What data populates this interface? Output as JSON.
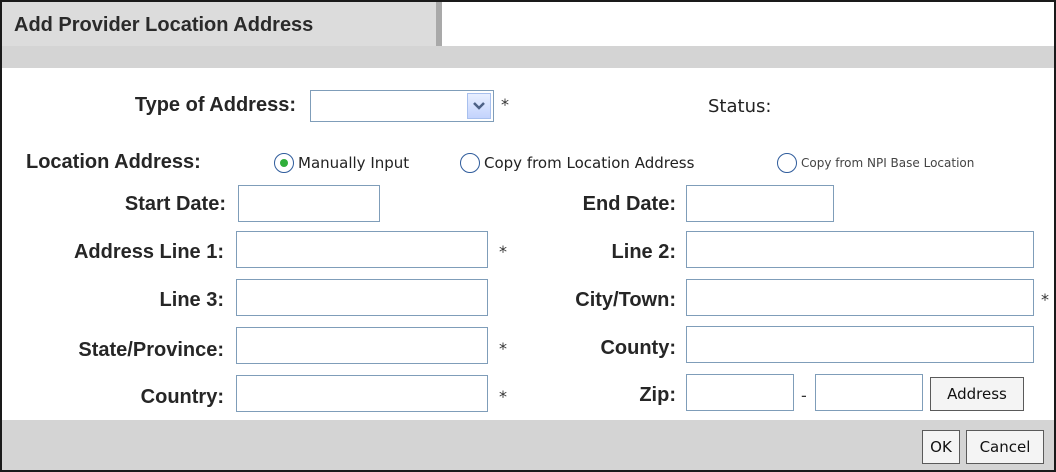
{
  "dialog": {
    "title": "Add Provider Location Address"
  },
  "form": {
    "type_of_address": {
      "label": "Type of Address:",
      "value": "",
      "required_mark": "*"
    },
    "status": {
      "label": "Status:"
    },
    "location_address": {
      "label": "Location Address:",
      "options": [
        {
          "label": "Manually Input",
          "selected": true
        },
        {
          "label": "Copy from Location Address",
          "selected": false
        },
        {
          "label": "Copy from NPI Base Location",
          "selected": false
        }
      ]
    },
    "start_date": {
      "label": "Start Date:",
      "value": ""
    },
    "end_date": {
      "label": "End Date:",
      "value": ""
    },
    "address_line_1": {
      "label": "Address Line 1:",
      "value": "",
      "required_mark": "*"
    },
    "line_2": {
      "label": "Line 2:",
      "value": ""
    },
    "line_3": {
      "label": "Line 3:",
      "value": ""
    },
    "city_town": {
      "label": "City/Town:",
      "value": "",
      "required_mark": "*"
    },
    "state_province": {
      "label": "State/Province:",
      "value": "",
      "required_mark": "*"
    },
    "county": {
      "label": "County:",
      "value": ""
    },
    "country": {
      "label": "Country:",
      "value": "",
      "required_mark": "*"
    },
    "zip": {
      "label": "Zip:",
      "value": "",
      "extension": "",
      "separator": "-"
    },
    "address_button": "Address"
  },
  "footer": {
    "ok_label": "OK",
    "cancel_label": "Cancel"
  },
  "colors": {
    "band": "#d4d4d4",
    "title_tab": "#dcdcdc",
    "field_border": "#7f9db9",
    "radio_selected": "#2fae3a"
  }
}
